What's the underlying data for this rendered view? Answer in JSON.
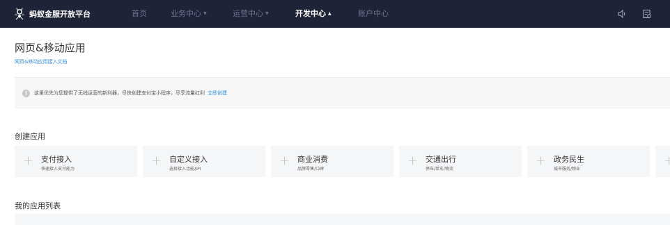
{
  "topbar": {
    "brand": "蚂蚁金服开放平台",
    "nav": [
      {
        "label": "首页",
        "caret": ""
      },
      {
        "label": "业务中心",
        "caret": "▼"
      },
      {
        "label": "运营中心",
        "caret": "▼"
      },
      {
        "label": "开发中心",
        "caret": "▲"
      },
      {
        "label": "账户中心",
        "caret": ""
      }
    ],
    "icons": [
      "speaker-icon",
      "document-icon"
    ]
  },
  "header": {
    "title": "网页&移动应用",
    "doc_link": "网页&移动应用接入文档"
  },
  "notice": {
    "icon_glyph": "!",
    "text": "这里优先为您提供了无线运营的新利器，尽快创建支付宝小程序，尽享流量红利",
    "link": "立即创建"
  },
  "create_section": {
    "title": "创建应用",
    "cards": [
      {
        "plus": "+",
        "title": "支付接入",
        "sub": "快速接入支付能力"
      },
      {
        "plus": "+",
        "title": "自定义接入",
        "sub": "选择接入功能API"
      },
      {
        "plus": "+",
        "title": "商业消费",
        "sub": "品牌零售/口碑"
      },
      {
        "plus": "+",
        "title": "交通出行",
        "sub": "停车/单车/物流"
      },
      {
        "plus": "+",
        "title": "政务民生",
        "sub": "城市服务/物业"
      },
      {
        "plus": "+",
        "title": "",
        "sub": ""
      }
    ]
  },
  "list_section": {
    "title": "我的应用列表"
  }
}
